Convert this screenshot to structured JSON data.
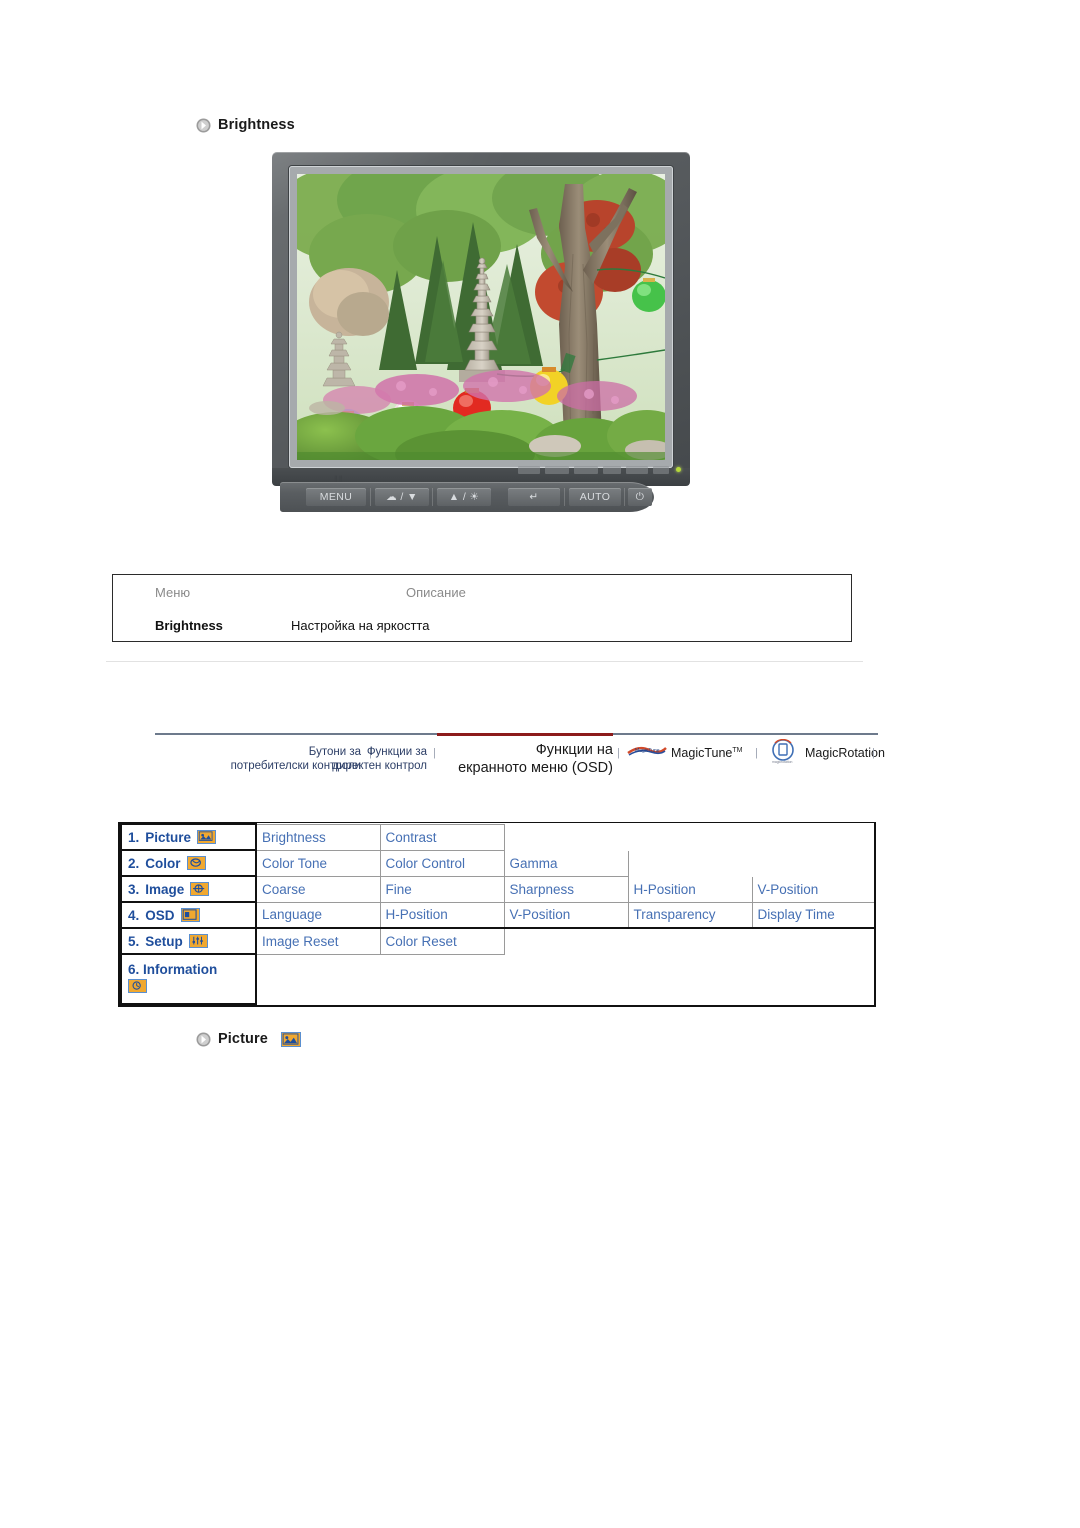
{
  "headings": {
    "brightness": "Brightness",
    "picture": "Picture"
  },
  "monitor": {
    "buttons": [
      {
        "label": "MENU",
        "name": "menu-button"
      },
      {
        "label": "☁ / ▼",
        "name": "down-button"
      },
      {
        "label": "▲ / ☀",
        "name": "up-brightness-button"
      },
      {
        "label": "↵",
        "name": "enter-button"
      },
      {
        "label": "AUTO",
        "name": "auto-button"
      },
      {
        "label": "⏻",
        "name": "power-button"
      }
    ],
    "menu_indicator": "‖‖"
  },
  "desc_table": {
    "headers": {
      "menu": "Меню",
      "description": "Описание"
    },
    "rows": [
      {
        "menu": "Brightness",
        "description": "Настройка на яркостта"
      }
    ]
  },
  "nav": {
    "items": [
      {
        "label": "Бутони за\nпотребителски контроли",
        "active": false
      },
      {
        "label": "Функции за\nдиректен контрол",
        "active": false
      },
      {
        "label": "Функции на\nекранното меню (OSD)",
        "active": true
      }
    ],
    "magictune": "MagicTune",
    "magictune_tm": "TM",
    "magicrotation": "MagicRotation",
    "separator": "|",
    "active_color": "#8c1b1b",
    "link_color": "#2c3e66"
  },
  "osd_table": {
    "categories": [
      {
        "index": "1.",
        "name": "Picture",
        "icon": "picture-icon"
      },
      {
        "index": "2.",
        "name": "Color",
        "icon": "color-icon"
      },
      {
        "index": "3.",
        "name": "Image",
        "icon": "image-icon"
      },
      {
        "index": "4.",
        "name": "OSD",
        "icon": "osd-icon"
      },
      {
        "index": "5.",
        "name": "Setup",
        "icon": "setup-icon"
      },
      {
        "index": "6.",
        "name": "Information",
        "icon": "information-icon"
      }
    ],
    "rows": [
      [
        "Brightness",
        "Contrast"
      ],
      [
        "Color Tone",
        "Color Control",
        "Gamma"
      ],
      [
        "Coarse",
        "Fine",
        "Sharpness",
        "H-Position",
        "V-Position"
      ],
      [
        "Language",
        "H-Position",
        "V-Position",
        "Transparency",
        "Display Time"
      ],
      [
        "Image Reset",
        "Color Reset"
      ],
      []
    ],
    "text_color": "#4670b4",
    "category_color": "#1f4e9c",
    "icon_fill": "#f0a830",
    "icon_border": "#5a8fd0"
  }
}
